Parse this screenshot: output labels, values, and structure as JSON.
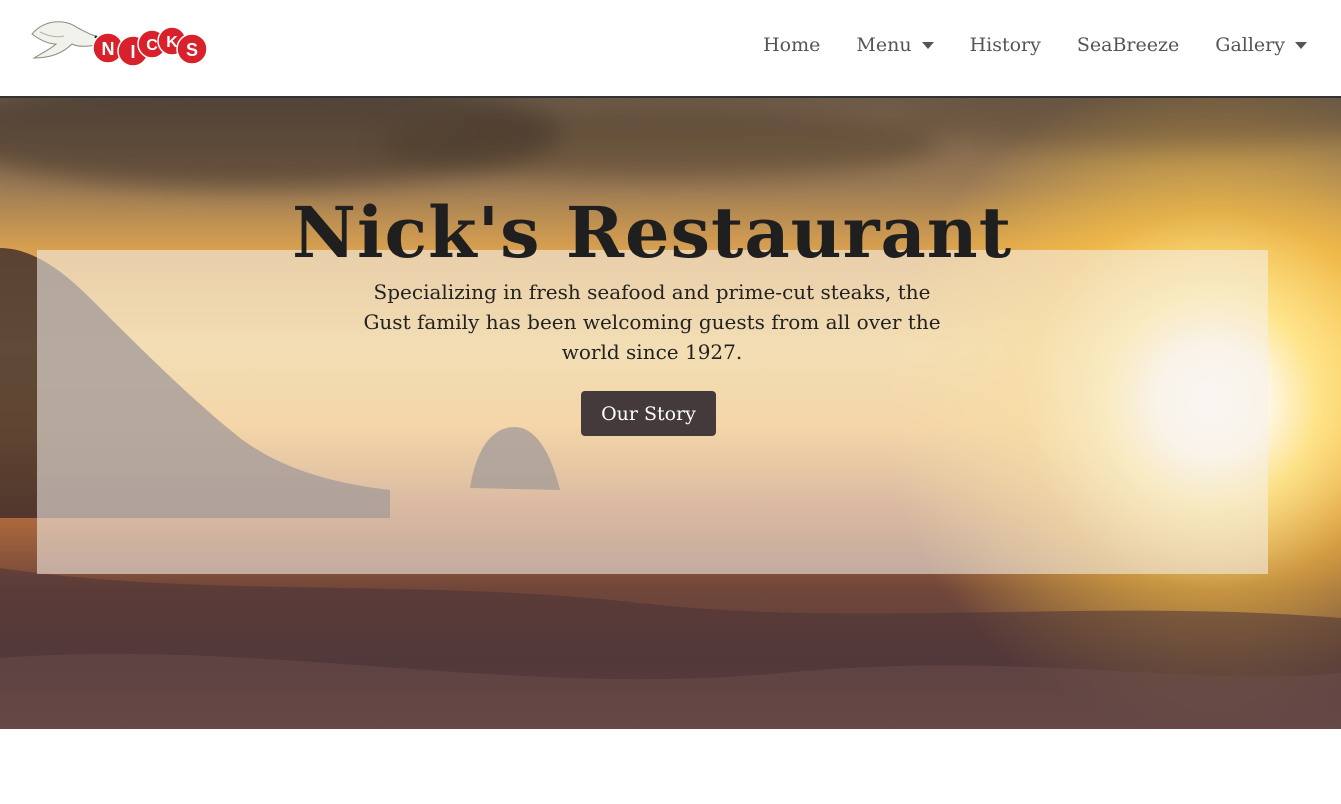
{
  "brand": {
    "logo_letters": [
      "N",
      "I",
      "C",
      "K",
      "S"
    ],
    "colors": {
      "logo_red": "#d8212b",
      "button": "#443a3c"
    }
  },
  "nav": {
    "items": [
      {
        "label": "Home",
        "dropdown": false
      },
      {
        "label": "Menu",
        "dropdown": true
      },
      {
        "label": "History",
        "dropdown": false
      },
      {
        "label": "SeaBreeze",
        "dropdown": false
      },
      {
        "label": "Gallery",
        "dropdown": true
      }
    ]
  },
  "hero": {
    "title": "Nick's Restaurant",
    "subtitle": "Specializing in fresh seafood and prime-cut steaks, the Gust family has been welcoming guests from all over the world since 1927.",
    "cta_label": "Our Story",
    "background": "sunset-over-ocean"
  }
}
